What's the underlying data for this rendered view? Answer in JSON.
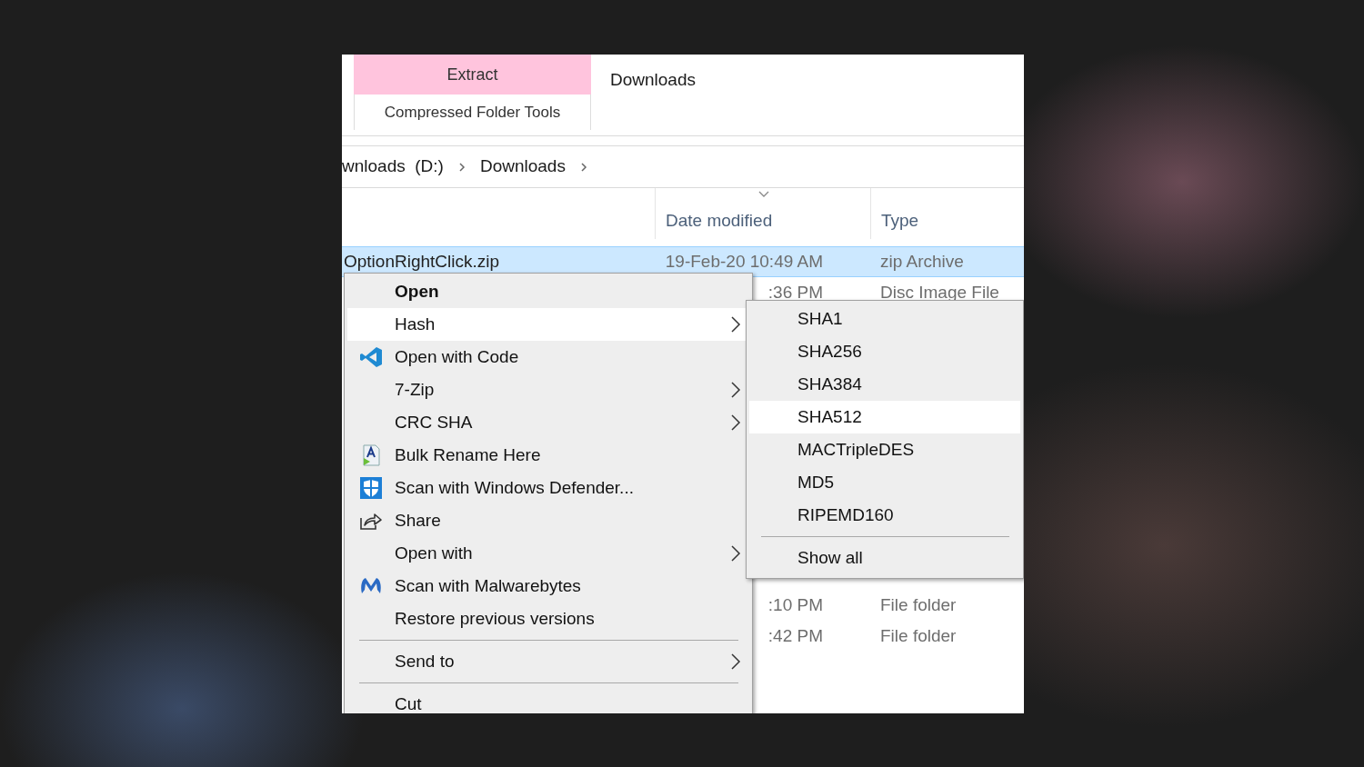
{
  "ribbon": {
    "contextual_tab": "Extract",
    "tab_group": "Compressed Folder Tools",
    "window_title": "Downloads"
  },
  "breadcrumb": [
    {
      "label": "wnloads  (D:)"
    },
    {
      "label": "Downloads"
    }
  ],
  "columns": [
    {
      "label": "Date modified",
      "sorted": true
    },
    {
      "label": "Type",
      "sorted": false
    }
  ],
  "files": [
    {
      "name": "OptionRightClick.zip",
      "date": "19-Feb-20 10:49 AM",
      "type": "zip Archive",
      "selected": true
    },
    {
      "date": ":36 PM",
      "type": "Disc Image File",
      "selected": false
    },
    {
      "date": ":10 PM",
      "type": "File folder",
      "selected": false,
      "gap_before": true
    },
    {
      "date": ":42 PM",
      "type": "File folder",
      "selected": false
    }
  ],
  "context_menu": [
    {
      "kind": "item",
      "label": "Open",
      "default": true,
      "selected": false,
      "submenu": false
    },
    {
      "kind": "item",
      "label": "Hash",
      "default": false,
      "selected": true,
      "submenu": true
    },
    {
      "kind": "item",
      "label": "Open with Code",
      "default": false,
      "selected": false,
      "submenu": false
    },
    {
      "kind": "item",
      "label": "7-Zip",
      "default": false,
      "selected": false,
      "submenu": true
    },
    {
      "kind": "item",
      "label": "CRC SHA",
      "default": false,
      "selected": false,
      "submenu": true
    },
    {
      "kind": "item",
      "label": "Bulk Rename Here",
      "default": false,
      "selected": false,
      "submenu": false
    },
    {
      "kind": "item",
      "label": "Scan with Windows Defender...",
      "default": false,
      "selected": false,
      "submenu": false
    },
    {
      "kind": "item",
      "label": "Share",
      "default": false,
      "selected": false,
      "submenu": false
    },
    {
      "kind": "item",
      "label": "Open with",
      "default": false,
      "selected": false,
      "submenu": true
    },
    {
      "kind": "item",
      "label": "Scan with Malwarebytes",
      "default": false,
      "selected": false,
      "submenu": false
    },
    {
      "kind": "item",
      "label": "Restore previous versions",
      "default": false,
      "selected": false,
      "submenu": false
    },
    {
      "kind": "separator"
    },
    {
      "kind": "item",
      "label": "Send to",
      "default": false,
      "selected": false,
      "submenu": true
    },
    {
      "kind": "separator"
    },
    {
      "kind": "item",
      "label": "Cut",
      "default": false,
      "selected": false,
      "submenu": false
    }
  ],
  "hash_submenu": [
    {
      "kind": "item",
      "label": "SHA1",
      "selected": false
    },
    {
      "kind": "item",
      "label": "SHA256",
      "selected": false
    },
    {
      "kind": "item",
      "label": "SHA384",
      "selected": false
    },
    {
      "kind": "item",
      "label": "SHA512",
      "selected": true
    },
    {
      "kind": "item",
      "label": "MACTripleDES",
      "selected": false
    },
    {
      "kind": "item",
      "label": "MD5",
      "selected": false
    },
    {
      "kind": "item",
      "label": "RIPEMD160",
      "selected": false
    },
    {
      "kind": "separator"
    },
    {
      "kind": "item",
      "label": "Show all",
      "selected": false
    }
  ]
}
